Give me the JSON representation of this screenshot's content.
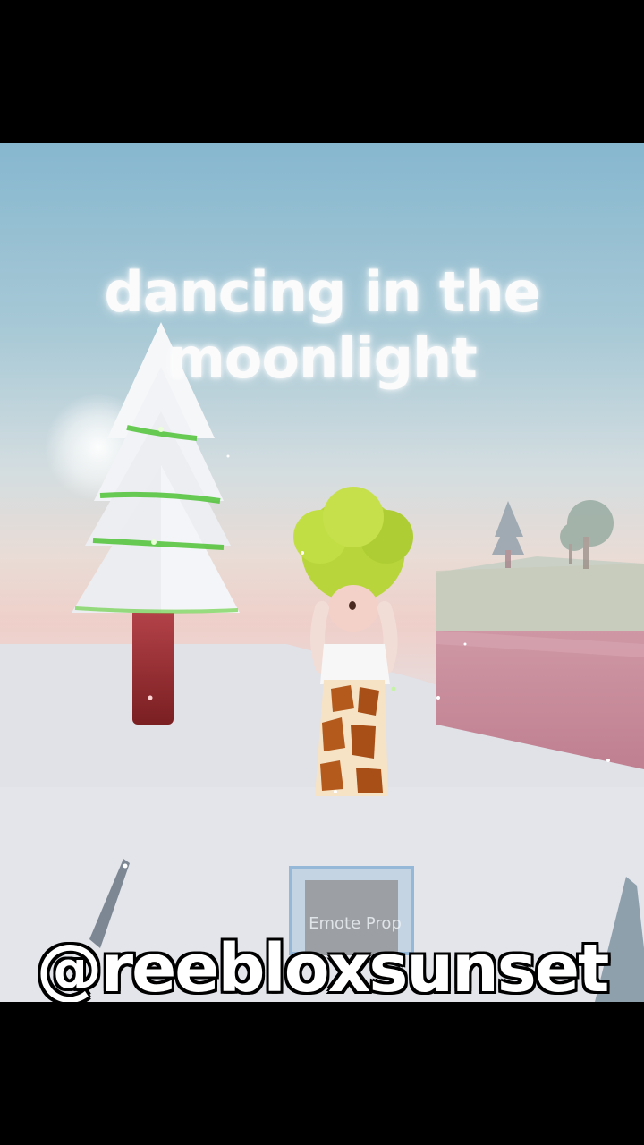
{
  "video": {
    "title_line1": "dancing in the",
    "title_line2": "moonlight",
    "watermark": "@reebloxsunset"
  },
  "game_ui": {
    "emote_button_label": "Emote Prop"
  },
  "colors": {
    "sky_top": "#86b7cf",
    "sunset_pink": "#efcfc9",
    "snow": "#e4e6ea",
    "tree_trunk": "#8a2a2c",
    "garland_green": "#4fc236",
    "hair_lime": "#b7d63a",
    "cliff_pink": "#c98d9b"
  }
}
